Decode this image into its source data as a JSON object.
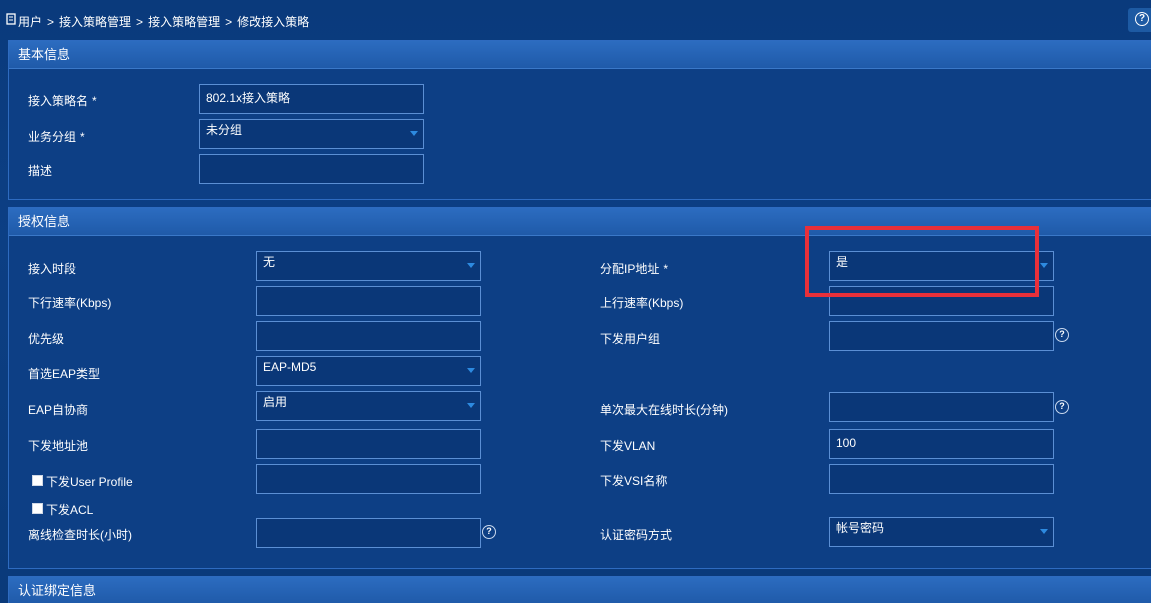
{
  "breadcrumb": {
    "items": [
      "用户",
      "接入策略管理",
      "接入策略管理",
      "修改接入策略"
    ],
    "separator": ">"
  },
  "help": {
    "icon": "help-icon",
    "glyph": "?"
  },
  "basic_info": {
    "title": "基本信息",
    "policy_name_label": "接入策略名",
    "policy_name_value": "802.1x接入策略",
    "group_label": "业务分组",
    "group_value": "未分组",
    "desc_label": "描述",
    "desc_value": "",
    "required_mark": "*"
  },
  "auth_info": {
    "title": "授权信息",
    "left": {
      "access_period_label": "接入时段",
      "access_period_value": "无",
      "downlink_rate_label": "下行速率(Kbps)",
      "downlink_rate_value": "",
      "priority_label": "优先级",
      "priority_value": "",
      "eap_type_label": "首选EAP类型",
      "eap_type_value": "EAP-MD5",
      "eap_negotiate_label": "EAP自协商",
      "eap_negotiate_value": "启用",
      "addr_pool_label": "下发地址池",
      "addr_pool_value": "",
      "user_profile_label": "下发User Profile",
      "user_profile_value": "",
      "acl_label": "下发ACL",
      "offline_check_label": "离线检查时长(小时)",
      "offline_check_value": ""
    },
    "right": {
      "assign_ip_label": "分配IP地址",
      "assign_ip_value": "是",
      "uplink_rate_label": "上行速率(Kbps)",
      "uplink_rate_value": "",
      "user_group_label": "下发用户组",
      "user_group_value": "",
      "max_online_label": "单次最大在线时长(分钟)",
      "max_online_value": "",
      "vlan_label": "下发VLAN",
      "vlan_value": "100",
      "vsi_label": "下发VSI名称",
      "vsi_value": "",
      "auth_pwd_label": "认证密码方式",
      "auth_pwd_value": "帐号密码"
    }
  },
  "binding_info": {
    "title": "认证绑定信息"
  },
  "colors": {
    "background": "#0b3a7a",
    "panel_header": "#2460b0",
    "highlight": "#e8303a",
    "select_arrow": "#2d8ae0"
  }
}
